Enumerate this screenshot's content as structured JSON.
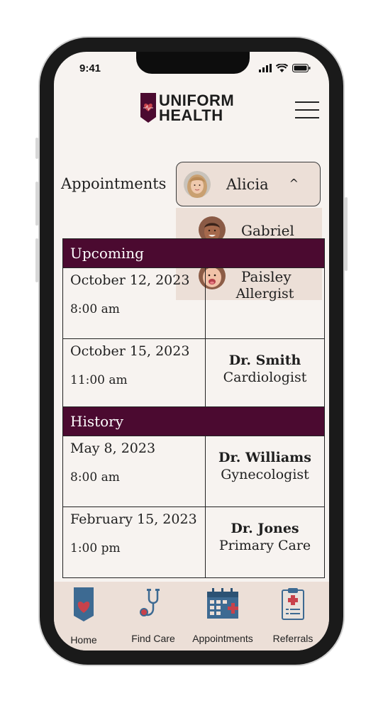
{
  "status_bar": {
    "time": "9:41"
  },
  "brand": {
    "line1": "UNIFORM",
    "line2": "HEALTH"
  },
  "header": {
    "section_label": "Appointments"
  },
  "profile_selector": {
    "selected": "Alicia",
    "options": [
      "Gabriel",
      "Paisley"
    ]
  },
  "upcoming": {
    "title": "Upcoming",
    "rows": [
      {
        "date": "October 12, 2023",
        "time": "8:00 am",
        "doctor": "",
        "specialty": "Allergist"
      },
      {
        "date": "October 15, 2023",
        "time": "11:00 am",
        "doctor": "Dr. Smith",
        "specialty": "Cardiologist"
      }
    ]
  },
  "history": {
    "title": "History",
    "rows": [
      {
        "date": "May 8, 2023",
        "time": "8:00 am",
        "doctor": "Dr. Williams",
        "specialty": "Gynecologist"
      },
      {
        "date": "February 15, 2023",
        "time": "1:00 pm",
        "doctor": "Dr. Jones",
        "specialty": "Primary Care"
      }
    ]
  },
  "tabbar": {
    "items": [
      {
        "label": "Home",
        "icon": "home-heart-icon"
      },
      {
        "label": "Find Care",
        "icon": "stethoscope-icon"
      },
      {
        "label": "Appointments",
        "icon": "calendar-icon"
      },
      {
        "label": "Referrals",
        "icon": "clipboard-icon"
      }
    ]
  },
  "colors": {
    "brand": "#4b0a30",
    "accent_red": "#c8424b",
    "icon_blue": "#3d6a92",
    "surface": "#ecdfd7"
  }
}
